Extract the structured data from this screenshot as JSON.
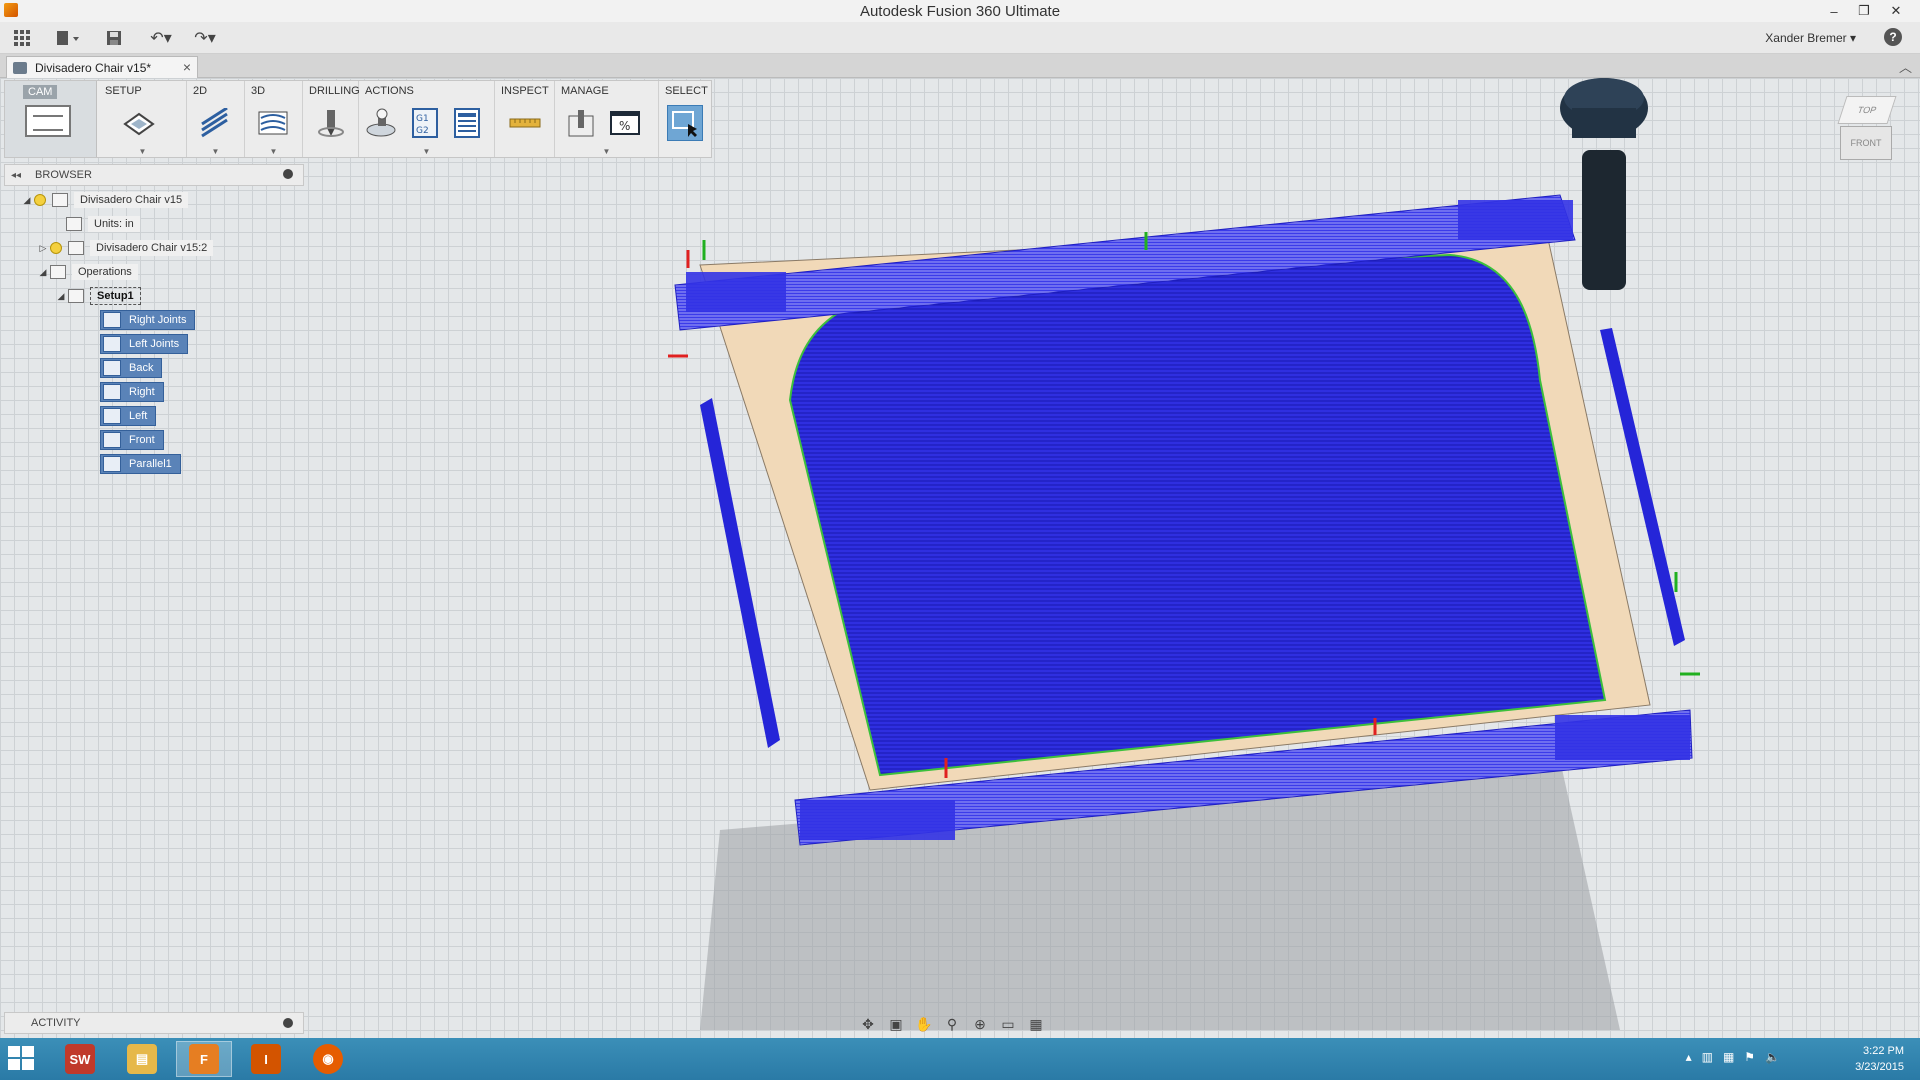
{
  "window": {
    "title": "Autodesk Fusion 360 Ultimate"
  },
  "quickbar": {
    "user": "Xander Bremer ▾",
    "help": "?"
  },
  "document_tab": {
    "label": "Divisadero Chair v15*",
    "close": "×"
  },
  "toolbar": {
    "workspace": "CAM",
    "groups": [
      "SETUP",
      "2D",
      "3D",
      "DRILLING",
      "ACTIONS",
      "INSPECT",
      "MANAGE",
      "SELECT"
    ]
  },
  "browser": {
    "title": "BROWSER",
    "root": "Divisadero Chair v15",
    "units": "Units: in",
    "component": "Divisadero Chair v15:2",
    "operations": "Operations",
    "setup": "Setup1",
    "operations_list": [
      "Right Joints",
      "Left Joints",
      "Back",
      "Right",
      "Left",
      "Front",
      "Parallel1"
    ]
  },
  "viewcube": {
    "top": "TOP",
    "front": "FRONT"
  },
  "activity": {
    "title": "ACTIVITY"
  },
  "taskbar": {
    "time": "3:22 PM",
    "date": "3/23/2015"
  },
  "colors": {
    "toolpath": "#2b2bd6",
    "stock": "#f1d9b8",
    "taskbar": "#3b8fb8"
  }
}
